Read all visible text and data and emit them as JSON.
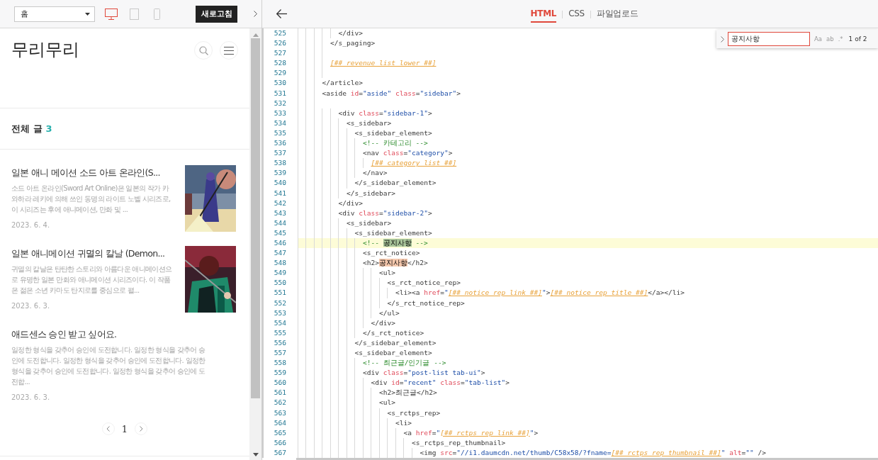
{
  "preview_toolbar": {
    "page_select": {
      "value": "홈"
    },
    "devices": [
      {
        "kind": "desktop",
        "selected": true
      },
      {
        "kind": "tablet",
        "selected": false
      },
      {
        "kind": "mobile",
        "selected": false
      }
    ],
    "refresh_button": "새로고침"
  },
  "blog": {
    "title": "무리무리",
    "post_count_label": "전체 글",
    "post_count": "3",
    "posts": [
      {
        "title": "일본 애니 메이션 소드 아트 온라인(S...",
        "excerpt": "소드 아트 온라인(Sword Art Online)은 일본의 작가 카와하라 레키에 의해 쓰인 동명의 라이트 노벨 시리즈로, 이 시리즈는 후에 애니메이션, 만화 및 ...",
        "date": "2023. 6. 4."
      },
      {
        "title": "일본 애니메이션 귀멸의 칼날 (Demon...",
        "excerpt": "귀멸의 칼날은 탄탄한 스토리와 아름다운 애니메이션으로 유명한 일본 만화와 애니메이션 시리즈이다. 이 작품은 젊은 소년 카마도 탄지로를 중심으로 펼...",
        "date": "2023. 6. 3."
      },
      {
        "title": "애드센스 승인 받고 싶어요.",
        "excerpt": "일정한 형식을 갖추어 승인에 도전합니다. 일정한 형식을 갖추어 승인에 도전합니다. 일정한 형식을 갖추어 승인에 도전합니다. 일정한 형식을 갖추어 승인에 도전합니다. 일정한 형식을 갖추어 승인에 도전합...",
        "date": "2023. 6. 3."
      }
    ],
    "pagination": {
      "pages": [
        "1"
      ]
    }
  },
  "editor": {
    "tabs": [
      {
        "label": "HTML",
        "selected": true
      },
      {
        "label": "CSS",
        "selected": false
      },
      {
        "label": "파일업로드",
        "selected": false
      }
    ],
    "search": {
      "value": "공지사항",
      "options": [
        {
          "label": "Aa",
          "on": false
        },
        {
          "label": "ab",
          "on": false
        },
        {
          "label": ".*",
          "on": false
        }
      ],
      "match_count": "1 of 2"
    },
    "lines": [
      {
        "number": "525",
        "current": false,
        "segments": [
          {
            "kind": "tag",
            "text": "          </div>"
          }
        ]
      },
      {
        "number": "526",
        "current": false,
        "segments": [
          {
            "kind": "tag",
            "text": "        </s_paging>"
          }
        ]
      },
      {
        "number": "527",
        "current": false
      },
      {
        "number": "528",
        "current": false,
        "segments": [
          {
            "kind": "var",
            "text": "        [##_revenue_list_lower_##]"
          }
        ]
      },
      {
        "number": "529",
        "current": false
      },
      {
        "number": "530",
        "current": false,
        "segments": [
          {
            "kind": "tag",
            "text": "      </article>"
          }
        ]
      },
      {
        "number": "531",
        "current": false,
        "segments": [
          {
            "kind": "tag",
            "text": "      <aside "
          },
          {
            "kind": "attr",
            "text": "id"
          },
          {
            "kind": "tag",
            "text": "="
          },
          {
            "kind": "string",
            "text": "\"aside\""
          },
          {
            "kind": "attr",
            "text": " class"
          },
          {
            "kind": "tag",
            "text": "="
          },
          {
            "kind": "string",
            "text": "\"sidebar\""
          },
          {
            "kind": "tag",
            "text": ">"
          }
        ]
      },
      {
        "number": "532",
        "current": false
      },
      {
        "number": "533",
        "current": false,
        "segments": [
          {
            "kind": "tag",
            "text": "          <div "
          },
          {
            "kind": "attr",
            "text": "class"
          },
          {
            "kind": "tag",
            "text": "="
          },
          {
            "kind": "string",
            "text": "\"sidebar-1\""
          },
          {
            "kind": "tag",
            "text": ">"
          }
        ]
      },
      {
        "number": "534",
        "current": false,
        "segments": [
          {
            "kind": "tag",
            "text": "            <s_sidebar>"
          }
        ]
      },
      {
        "number": "535",
        "current": false,
        "segments": [
          {
            "kind": "tag",
            "text": "              <s_sidebar_element>"
          }
        ]
      },
      {
        "number": "536",
        "current": false,
        "segments": [
          {
            "kind": "comment",
            "text": "                <!-- 카테고리 -->"
          }
        ]
      },
      {
        "number": "537",
        "current": false,
        "segments": [
          {
            "kind": "tag",
            "text": "                <nav "
          },
          {
            "kind": "attr",
            "text": "class"
          },
          {
            "kind": "tag",
            "text": "="
          },
          {
            "kind": "string",
            "text": "\"category\""
          },
          {
            "kind": "tag",
            "text": ">"
          }
        ]
      },
      {
        "number": "538",
        "current": false,
        "segments": [
          {
            "kind": "var",
            "text": "                  [##_category_list_##]"
          }
        ]
      },
      {
        "number": "539",
        "current": false,
        "segments": [
          {
            "kind": "tag",
            "text": "                </nav>"
          }
        ]
      },
      {
        "number": "540",
        "current": false,
        "segments": [
          {
            "kind": "tag",
            "text": "              </s_sidebar_element>"
          }
        ]
      },
      {
        "number": "541",
        "current": false,
        "segments": [
          {
            "kind": "tag",
            "text": "            </s_sidebar>"
          }
        ]
      },
      {
        "number": "542",
        "current": false,
        "segments": [
          {
            "kind": "tag",
            "text": "          </div>"
          }
        ]
      },
      {
        "number": "543",
        "current": false,
        "segments": [
          {
            "kind": "tag",
            "text": "          <div "
          },
          {
            "kind": "attr",
            "text": "class"
          },
          {
            "kind": "tag",
            "text": "="
          },
          {
            "kind": "string",
            "text": "\"sidebar-2\""
          },
          {
            "kind": "tag",
            "text": ">"
          }
        ]
      },
      {
        "number": "544",
        "current": false,
        "segments": [
          {
            "kind": "tag",
            "text": "            <s_sidebar>"
          }
        ]
      },
      {
        "number": "545",
        "current": false,
        "segments": [
          {
            "kind": "tag",
            "text": "              <s_sidebar_element>"
          }
        ]
      },
      {
        "number": "546",
        "current": true,
        "segments": [
          {
            "kind": "comment",
            "text": "                <!-- "
          },
          {
            "kind": "match",
            "selected": true,
            "text": "공지사항"
          },
          {
            "kind": "comment",
            "text": " -->"
          }
        ]
      },
      {
        "number": "547",
        "current": false,
        "segments": [
          {
            "kind": "tag",
            "text": "                <s_rct_notice>"
          }
        ]
      },
      {
        "number": "548",
        "current": false,
        "segments": [
          {
            "kind": "tag",
            "text": "                <h2>"
          },
          {
            "kind": "match",
            "selected": false,
            "text": "공지사항"
          },
          {
            "kind": "tag",
            "text": "</h2>"
          }
        ]
      },
      {
        "number": "549",
        "current": false,
        "segments": [
          {
            "kind": "tag",
            "text": "                    <ul>"
          }
        ]
      },
      {
        "number": "550",
        "current": false,
        "segments": [
          {
            "kind": "tag",
            "text": "                      <s_rct_notice_rep>"
          }
        ]
      },
      {
        "number": "551",
        "current": false,
        "segments": [
          {
            "kind": "tag",
            "text": "                        <li><a "
          },
          {
            "kind": "attr",
            "text": "href"
          },
          {
            "kind": "tag",
            "text": "="
          },
          {
            "kind": "string",
            "text": "\""
          },
          {
            "kind": "var",
            "text": "[##_notice_rep_link_##]"
          },
          {
            "kind": "string",
            "text": "\""
          },
          {
            "kind": "tag",
            "text": ">"
          },
          {
            "kind": "var",
            "text": "[##_notice_rep_title_##]"
          },
          {
            "kind": "tag",
            "text": "</a></li>"
          }
        ]
      },
      {
        "number": "552",
        "current": false,
        "segments": [
          {
            "kind": "tag",
            "text": "                      </s_rct_notice_rep>"
          }
        ]
      },
      {
        "number": "553",
        "current": false,
        "segments": [
          {
            "kind": "tag",
            "text": "                    </ul>"
          }
        ]
      },
      {
        "number": "554",
        "current": false,
        "segments": [
          {
            "kind": "tag",
            "text": "                  </div>"
          }
        ]
      },
      {
        "number": "555",
        "current": false,
        "segments": [
          {
            "kind": "tag",
            "text": "                </s_rct_notice>"
          }
        ]
      },
      {
        "number": "556",
        "current": false,
        "segments": [
          {
            "kind": "tag",
            "text": "              </s_sidebar_element>"
          }
        ]
      },
      {
        "number": "557",
        "current": false,
        "segments": [
          {
            "kind": "tag",
            "text": "              <s_sidebar_element>"
          }
        ]
      },
      {
        "number": "558",
        "current": false,
        "segments": [
          {
            "kind": "comment",
            "text": "                <!-- 최근글/인기글 -->"
          }
        ]
      },
      {
        "number": "559",
        "current": false,
        "segments": [
          {
            "kind": "tag",
            "text": "                <div "
          },
          {
            "kind": "attr",
            "text": "class"
          },
          {
            "kind": "tag",
            "text": "="
          },
          {
            "kind": "string",
            "text": "\"post-list tab-ui\""
          },
          {
            "kind": "tag",
            "text": ">"
          }
        ]
      },
      {
        "number": "560",
        "current": false,
        "segments": [
          {
            "kind": "tag",
            "text": "                  <div "
          },
          {
            "kind": "attr",
            "text": "id"
          },
          {
            "kind": "tag",
            "text": "="
          },
          {
            "kind": "string",
            "text": "\"recent\""
          },
          {
            "kind": "attr",
            "text": " class"
          },
          {
            "kind": "tag",
            "text": "="
          },
          {
            "kind": "string",
            "text": "\"tab-list\""
          },
          {
            "kind": "tag",
            "text": ">"
          }
        ]
      },
      {
        "number": "561",
        "current": false,
        "segments": [
          {
            "kind": "tag",
            "text": "                    <h2>최근글</h2>"
          }
        ]
      },
      {
        "number": "562",
        "current": false,
        "segments": [
          {
            "kind": "tag",
            "text": "                    <ul>"
          }
        ]
      },
      {
        "number": "563",
        "current": false,
        "segments": [
          {
            "kind": "tag",
            "text": "                      <s_rctps_rep>"
          }
        ]
      },
      {
        "number": "564",
        "current": false,
        "segments": [
          {
            "kind": "tag",
            "text": "                        <li>"
          }
        ]
      },
      {
        "number": "565",
        "current": false,
        "segments": [
          {
            "kind": "tag",
            "text": "                          <a "
          },
          {
            "kind": "attr",
            "text": "href"
          },
          {
            "kind": "tag",
            "text": "="
          },
          {
            "kind": "string",
            "text": "\""
          },
          {
            "kind": "var",
            "text": "[##_rctps_rep_link_##]"
          },
          {
            "kind": "string",
            "text": "\""
          },
          {
            "kind": "tag",
            "text": ">"
          }
        ]
      },
      {
        "number": "566",
        "current": false,
        "segments": [
          {
            "kind": "tag",
            "text": "                            <s_rctps_rep_thumbnail>"
          }
        ]
      },
      {
        "number": "567",
        "current": false,
        "segments": [
          {
            "kind": "tag",
            "text": "                              <img "
          },
          {
            "kind": "attr",
            "text": "src"
          },
          {
            "kind": "tag",
            "text": "="
          },
          {
            "kind": "string",
            "text": "\"//i1.daumcdn.net/thumb/C58x58/?fname="
          },
          {
            "kind": "var",
            "text": "[##_rctps_rep_thumbnail_##]"
          },
          {
            "kind": "string",
            "text": "\""
          },
          {
            "kind": "attr",
            "text": " alt"
          },
          {
            "kind": "tag",
            "text": "="
          },
          {
            "kind": "string",
            "text": "\"\""
          },
          {
            "kind": "tag",
            "text": " />"
          }
        ]
      }
    ]
  }
}
